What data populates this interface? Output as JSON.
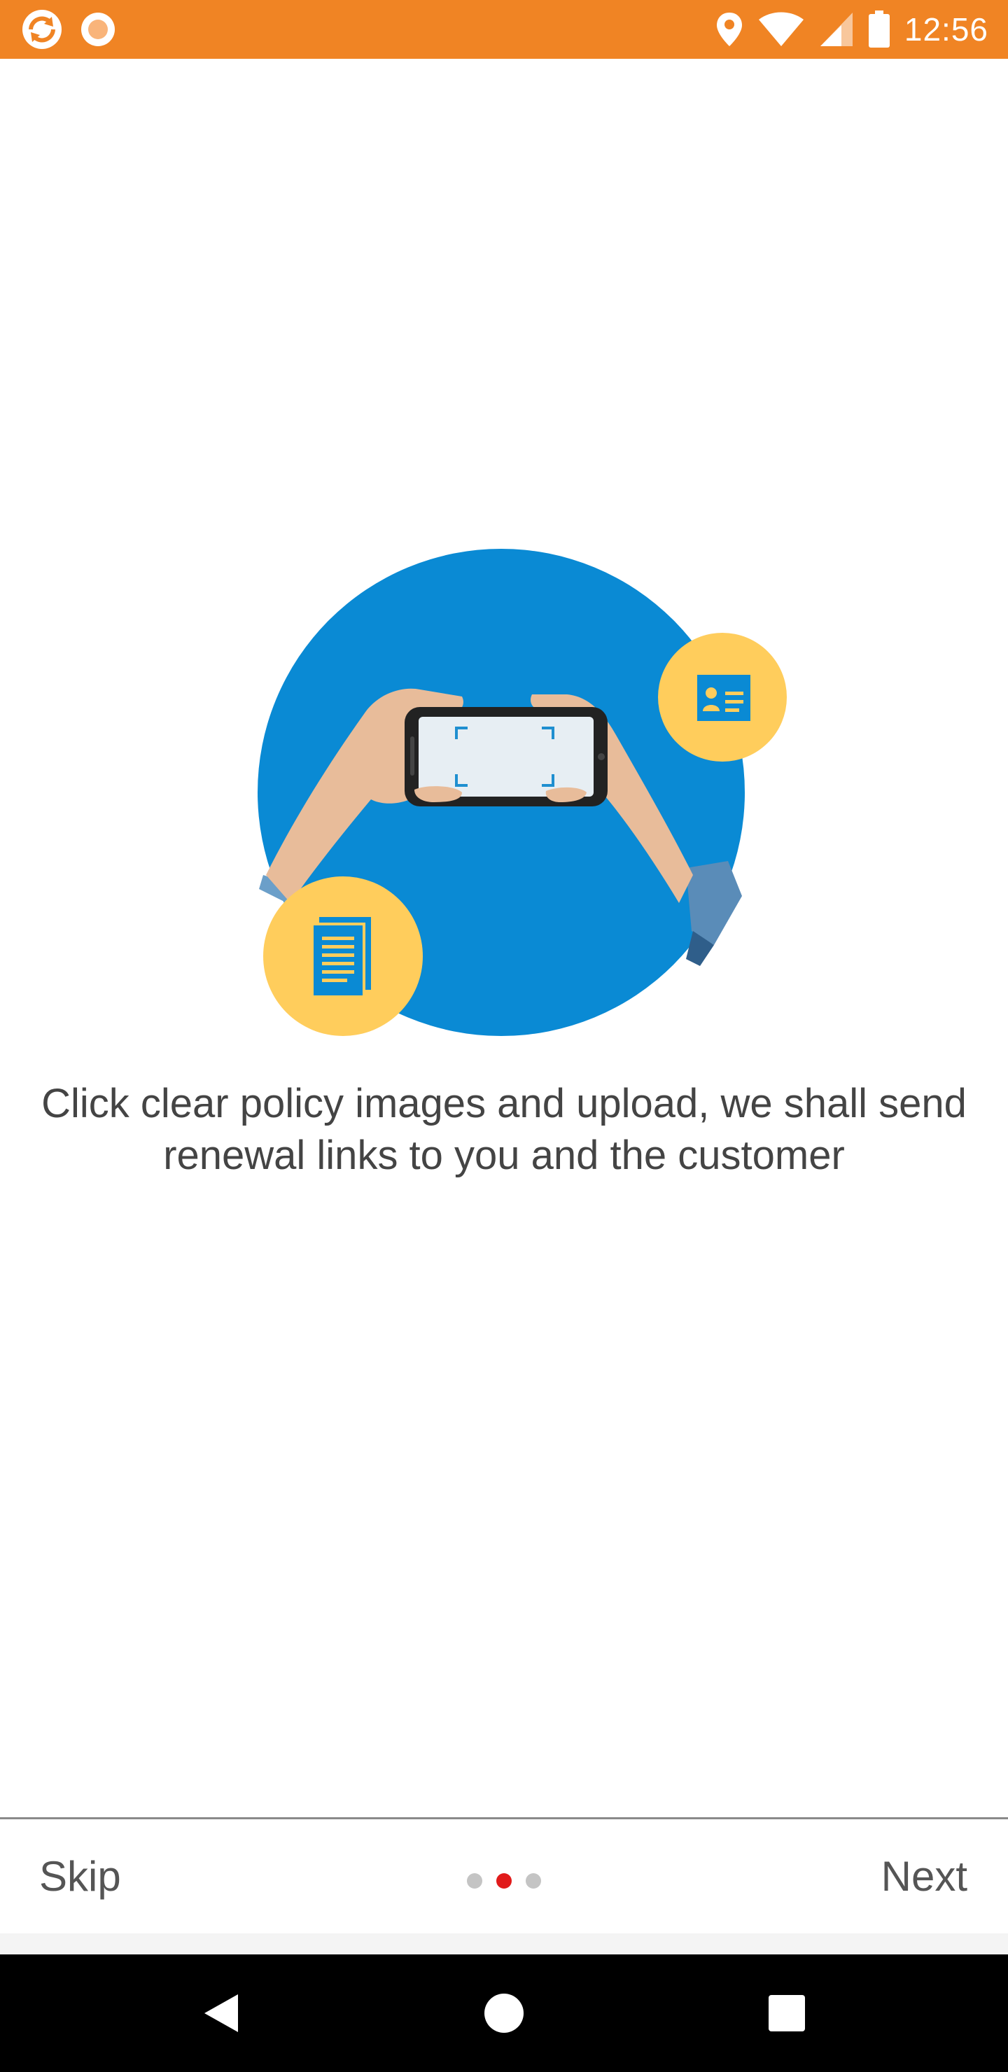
{
  "status_bar": {
    "time": "12:56",
    "left_icons": [
      "app-sync-icon",
      "record-icon"
    ],
    "right_icons": [
      "location-icon",
      "wifi-icon",
      "signal-icon",
      "battery-icon"
    ],
    "background_color": "#f08424"
  },
  "onboarding": {
    "message": "Click clear policy images and upload, we shall send renewal links to you and the customer",
    "illustration": "phone-photographing-documents-illustration",
    "page_indicator": {
      "total": 3,
      "current": 2
    },
    "skip_label": "Skip",
    "next_label": "Next"
  },
  "colors": {
    "accent_blue": "#0a8ad4",
    "accent_yellow": "#ffcd5c",
    "active_dot": "#e11b1b",
    "inactive_dot": "#c4c4c4"
  },
  "nav_bar": {
    "buttons": [
      "back-icon",
      "home-icon",
      "recents-icon"
    ]
  }
}
